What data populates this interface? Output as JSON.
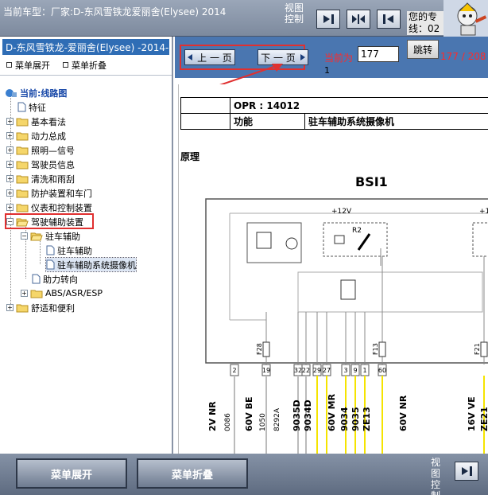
{
  "topbar": {
    "vehicle_label": "当前车型：厂家:D-东风雪铁龙爱丽舍(Elysee)    2014",
    "view_control_label": "视图控制",
    "expert_text": "您的专线：02"
  },
  "sidebar": {
    "title": "D-东风雪铁龙-爱丽舍(Elysee)   -2014-",
    "expand_label": "菜单展开",
    "collapse_label": "菜单折叠",
    "current_label": "当前:线路图",
    "items": [
      {
        "label": "特征"
      },
      {
        "label": "基本看法"
      },
      {
        "label": "动力总成"
      },
      {
        "label": "照明—信号"
      },
      {
        "label": "驾驶员信息"
      },
      {
        "label": "清洗和雨刮"
      },
      {
        "label": "防护装置和车门"
      },
      {
        "label": "仪表和控制装置"
      },
      {
        "label": "驾驶辅助装置"
      },
      {
        "label": "驻车辅助"
      },
      {
        "label": "驻车辅助"
      },
      {
        "label": "驻车辅助系统摄像机"
      },
      {
        "label": "助力转向"
      },
      {
        "label": "ABS/ASR/ESP"
      },
      {
        "label": "舒适和便利"
      }
    ]
  },
  "nav": {
    "prev_label": "上 一 页",
    "next_label": "下 一 页",
    "current_page_label": "当前为",
    "page_value": "177",
    "jump_label": "跳转",
    "page_count": "177 / 208 /",
    "page_count_line2": "1"
  },
  "document": {
    "opr": "OPR : 14012",
    "function_label": "功能",
    "function_value": "驻车辅助系统摄像机",
    "principle_label": "原理",
    "schematic": {
      "module_label": "BSI1",
      "voltage_label": "+12V",
      "relay_label": "R2",
      "fuse_labels": [
        "F28",
        "F13",
        "F21"
      ],
      "pin_numbers": [
        "2",
        "19",
        "32",
        "22",
        "29",
        "27",
        "3",
        "9",
        "1",
        "60"
      ],
      "wire_labels": [
        "2V NR",
        "0086",
        "60V BE",
        "1050",
        "8292A",
        "9035D",
        "9034D",
        "60V MR",
        "9034",
        "9035",
        "ZE13",
        "60V NR",
        "16V VE",
        "ZE21"
      ]
    }
  },
  "bottombar": {
    "expand_label": "菜单展开",
    "collapse_label": "菜单折叠",
    "view_control_label": "视图控制"
  },
  "colors": {
    "highlight_red": "#e03030",
    "nav_blue": "#4a76b0",
    "sidebar_title_blue": "#2f6db5",
    "wire_yellow": "#f5e400",
    "page_red": "#ff2a2a"
  }
}
